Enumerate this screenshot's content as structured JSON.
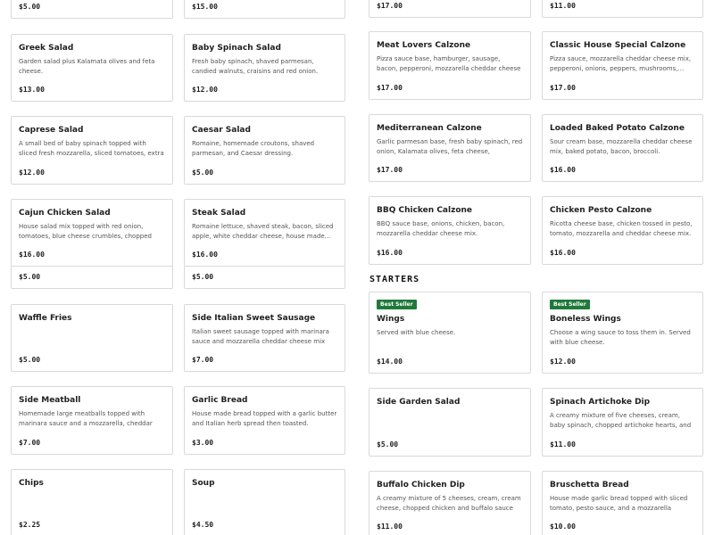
{
  "left_column": {
    "top_prices": [
      "$5.00",
      "$15.00"
    ],
    "items": [
      {
        "name": "Greek Salad",
        "desc": "Garden salad plus Kalamata olives and feta cheese.",
        "price": "$13.00"
      },
      {
        "name": "Baby Spinach Salad",
        "desc": "Fresh baby spinach, shaved parmesan, candied walnuts, craisins and red onion.",
        "price": "$12.00"
      },
      {
        "name": "Caprese Salad",
        "desc": "A small bed of baby spinach topped with sliced fresh mozzarella, sliced tomatoes, extra virgin...",
        "price": "$12.00"
      },
      {
        "name": "Caesar Salad",
        "desc": "Romaine, homemade croutons, shaved parmesan, and Caesar dressing.",
        "price": "$5.00"
      },
      {
        "name": "Cajun Chicken Salad",
        "desc": "House salad mix topped with red onion, tomatoes, blue cheese crumbles, chopped bacon, crispy...",
        "price": "$16.00"
      },
      {
        "name": "Steak Salad",
        "desc": "Romaine lettuce, shaved steak, bacon, sliced apple, white cheddar cheese, house made...",
        "price": "$16.00"
      },
      {
        "name": "Waffle Fries",
        "desc": "",
        "price": "$5.00"
      },
      {
        "name": "Side Italian Sweet Sausage",
        "desc": "Italian sweet sausage topped with marinara sauce and mozzarella cheddar cheese mix then baked i...",
        "price": "$7.00"
      },
      {
        "name": "Side Meatball",
        "desc": "Homemade large meatballs topped with marinara sauce and a mozzarella, cheddar cheese mix the...",
        "price": "$7.00"
      },
      {
        "name": "Garlic Bread",
        "desc": "House made bread topped with a garlic butter and Italian herb spread then toasted.",
        "price": "$3.00"
      },
      {
        "name": "Chips",
        "desc": "",
        "price": "$2.25"
      },
      {
        "name": "Soup",
        "desc": "",
        "price": "$4.50"
      }
    ],
    "mid_prices": [
      "$5.00",
      "$5.00"
    ]
  },
  "right_column": {
    "top_prices": [
      "$17.00",
      "$11.00"
    ],
    "calzones": [
      {
        "name": "Meat Lovers Calzone",
        "desc": "Pizza sauce base, hamburger, sausage, bacon, pepperoni, mozzarella cheddar cheese mix.",
        "price": "$17.00"
      },
      {
        "name": "Classic House Special Calzone",
        "desc": "Pizza sauce, mozzarella cheddar cheese mix, pepperoni, onions, peppers, mushrooms,...",
        "price": "$17.00"
      },
      {
        "name": "Mediterranean Calzone",
        "desc": "Garlic parmesan base, fresh baby spinach, red onion, Kalamata olives, feta cheese, artichoke...",
        "price": "$17.00"
      },
      {
        "name": "Loaded Baked Potato Calzone",
        "desc": "Sour cream base, mozzarella cheddar cheese mix, baked potato, bacon, broccoli.",
        "price": "$16.00"
      },
      {
        "name": "BBQ Chicken Calzone",
        "desc": "BBQ sauce base, onions, chicken, bacon, mozzarella cheddar cheese mix.",
        "price": "$16.00"
      },
      {
        "name": "Chicken Pesto Calzone",
        "desc": "Ricotta cheese base, chicken tossed in pesto, tomato, mozzarella and cheddar cheese mix.",
        "price": "$16.00"
      }
    ],
    "starters_title": "STARTERS",
    "starters": [
      {
        "badge": "Best Seller",
        "name": "Wings",
        "desc": "Served with blue cheese.",
        "price": "$14.00"
      },
      {
        "badge": "Best Seller",
        "name": "Boneless Wings",
        "desc": "Choose a wing sauce to toss them in. Served with blue cheese.",
        "price": "$12.00"
      },
      {
        "badge": "",
        "name": "Side Garden Salad",
        "desc": "",
        "price": "$5.00"
      },
      {
        "badge": "",
        "name": "Spinach Artichoke Dip",
        "desc": "A creamy mixture of five cheeses, cream, baby spinach, chopped artichoke hearts, and cream...",
        "price": "$11.00"
      },
      {
        "badge": "",
        "name": "Buffalo Chicken Dip",
        "desc": "A creamy mixture of 5 cheeses, cream, cream cheese, chopped chicken and buffalo sauce bak...",
        "price": "$11.00"
      },
      {
        "badge": "",
        "name": "Bruschetta Bread",
        "desc": "House made garlic bread topped with sliced tomato, pesto sauce, and a mozzarella cheese m...",
        "price": "$10.00"
      }
    ]
  },
  "colors": {
    "badge_bg": "#1f7a3a",
    "border": "#d9d9d9",
    "text": "#1f1f1f",
    "muted": "#555555"
  }
}
